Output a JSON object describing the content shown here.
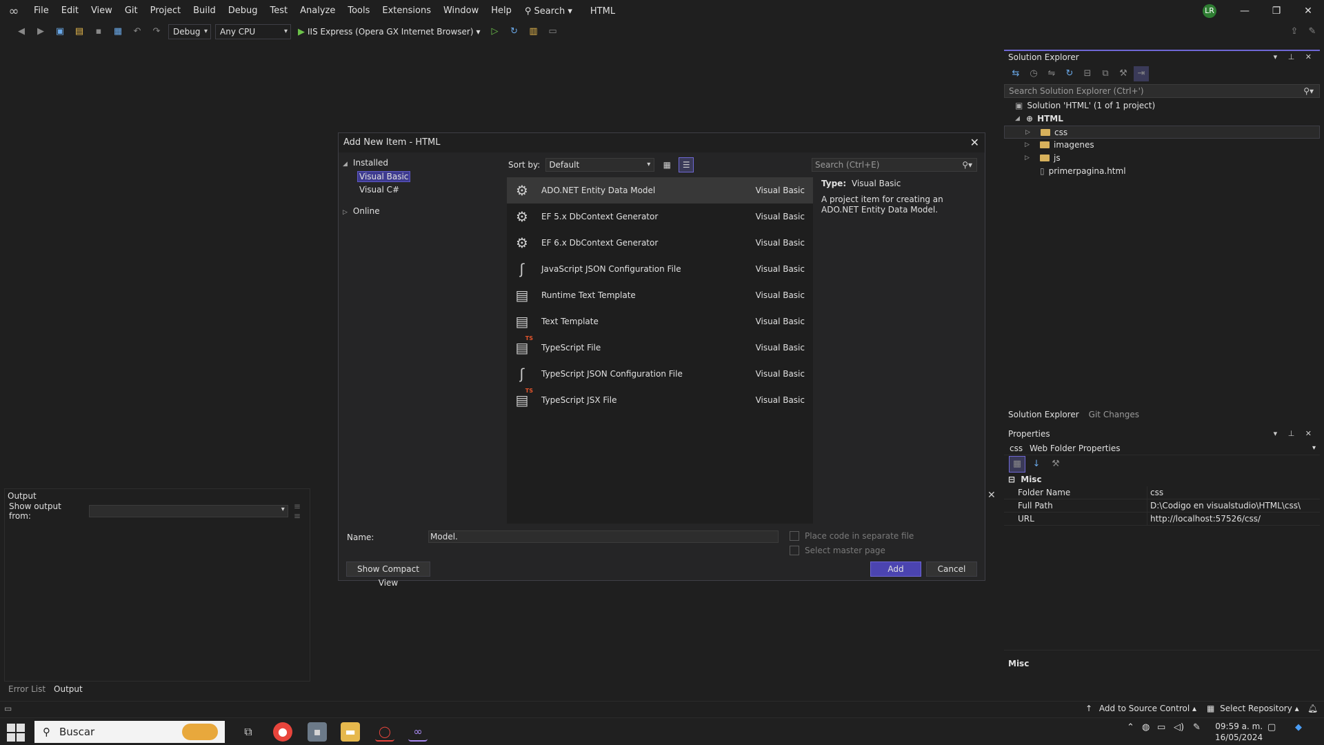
{
  "menubar": {
    "items": [
      "File",
      "Edit",
      "View",
      "Git",
      "Project",
      "Build",
      "Debug",
      "Test",
      "Analyze",
      "Tools",
      "Extensions",
      "Window",
      "Help"
    ],
    "search": "Search",
    "solution": "HTML",
    "avatar": "LR"
  },
  "toolbar": {
    "config": "Debug",
    "platform": "Any CPU",
    "run_target": "IIS Express (Opera GX Internet Browser)"
  },
  "solution_explorer": {
    "title": "Solution Explorer",
    "search_placeholder": "Search Solution Explorer (Ctrl+')",
    "solution_label": "Solution 'HTML' (1 of 1 project)",
    "project": "HTML",
    "folders": [
      "css",
      "imagenes",
      "js"
    ],
    "file": "primerpagina.html",
    "tabs": [
      "Solution Explorer",
      "Git Changes"
    ]
  },
  "properties": {
    "title": "Properties",
    "object_name": "css",
    "object_type": "Web Folder Properties",
    "category": "Misc",
    "rows": [
      {
        "key": "Folder Name",
        "value": "css"
      },
      {
        "key": "Full Path",
        "value": "D:\\Codigo en visualstudio\\HTML\\css\\"
      },
      {
        "key": "URL",
        "value": "http://localhost:57526/css/"
      }
    ],
    "description": "Misc"
  },
  "output": {
    "title": "Output",
    "show_from": "Show output from:",
    "tabs": [
      "Error List",
      "Output"
    ]
  },
  "dialog": {
    "title": "Add New Item - HTML",
    "installed": "Installed",
    "visual_basic": "Visual Basic",
    "visual_csharp": "Visual C#",
    "online": "Online",
    "sort_by": "Sort by:",
    "sort_value": "Default",
    "search_placeholder": "Search (Ctrl+E)",
    "items": [
      {
        "name": "ADO.NET Entity Data Model",
        "lang": "Visual Basic",
        "icon": "entity-icon"
      },
      {
        "name": "EF 5.x DbContext Generator",
        "lang": "Visual Basic",
        "icon": "entity-icon"
      },
      {
        "name": "EF 6.x DbContext Generator",
        "lang": "Visual Basic",
        "icon": "entity-icon"
      },
      {
        "name": "JavaScript JSON Configuration File",
        "lang": "Visual Basic",
        "icon": "json-icon"
      },
      {
        "name": "Runtime Text Template",
        "lang": "Visual Basic",
        "icon": "document-icon"
      },
      {
        "name": "Text Template",
        "lang": "Visual Basic",
        "icon": "document-icon"
      },
      {
        "name": "TypeScript File",
        "lang": "Visual Basic",
        "icon": "typescript-icon"
      },
      {
        "name": "TypeScript JSON Configuration File",
        "lang": "Visual Basic",
        "icon": "json-icon"
      },
      {
        "name": "TypeScript JSX File",
        "lang": "Visual Basic",
        "icon": "typescript-icon"
      }
    ],
    "info_type_label": "Type:",
    "info_type_value": "Visual Basic",
    "info_desc": "A project item for creating an ADO.NET Entity Data Model.",
    "name_label": "Name:",
    "name_value": "Model.",
    "place_code": "Place code in separate file",
    "select_master": "Select master page",
    "compact_view": "Show Compact View",
    "add": "Add",
    "cancel": "Cancel"
  },
  "status": {
    "source_control": "Add to Source Control",
    "repository": "Select Repository"
  },
  "taskbar": {
    "search": "Buscar",
    "time": "09:59 a. m.",
    "date": "16/05/2024"
  },
  "colors": {
    "accent": "#6f68d6",
    "primary_button": "#4b44b0",
    "folder": "#d7b15c"
  }
}
